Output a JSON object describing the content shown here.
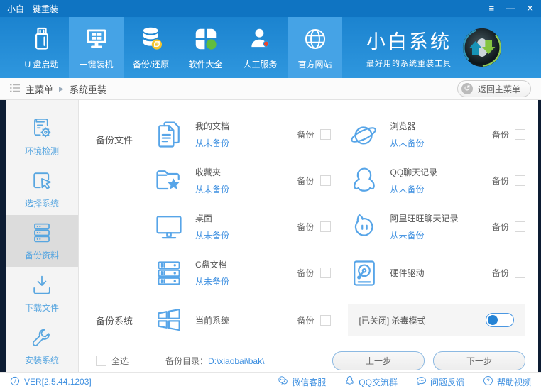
{
  "window": {
    "title": "小白一键重装",
    "controls": {
      "menu": "≡",
      "minimize": "—",
      "close": "✕"
    }
  },
  "colors": {
    "header_blue": "#1b83cf",
    "accent_blue": "#3d8fe0",
    "icon_blue": "#57a5e8",
    "active_nav": "#45a3e6",
    "green": "#61bd3e",
    "yellow": "#f6c52e",
    "red": "#e8452e",
    "dark_edge": "#0d1c33"
  },
  "nav": {
    "items": [
      {
        "key": "usb-boot",
        "label": "U 盘启动",
        "icon": "usb-drive-icon",
        "active": false
      },
      {
        "key": "onekey-install",
        "label": "一键装机",
        "icon": "monitor-icon",
        "active": true
      },
      {
        "key": "backup-restore",
        "label": "备份/还原",
        "icon": "database-icon",
        "active": false
      },
      {
        "key": "software",
        "label": "软件大全",
        "icon": "apps-icon",
        "active": false
      },
      {
        "key": "support",
        "label": "人工服务",
        "icon": "support-icon",
        "active": false
      },
      {
        "key": "official-site",
        "label": "官方网站",
        "icon": "globe-icon",
        "active": true
      }
    ],
    "brand": {
      "name": "小白系统",
      "slogan": "最好用的系统重装工具"
    }
  },
  "breadcrumb": {
    "root": "主菜单",
    "separator": "▶",
    "current": "系统重装",
    "back_button": "返回主菜单"
  },
  "sidebar": {
    "items": [
      {
        "key": "env-check",
        "label": "环境检测",
        "icon": "env-check-icon",
        "active": false
      },
      {
        "key": "select-system",
        "label": "选择系统",
        "icon": "select-system-icon",
        "active": false
      },
      {
        "key": "backup-data",
        "label": "备份资料",
        "icon": "backup-data-icon",
        "active": true
      },
      {
        "key": "download-files",
        "label": "下载文件",
        "icon": "download-icon",
        "active": false
      },
      {
        "key": "install-system",
        "label": "安装系统",
        "icon": "install-icon",
        "active": false
      }
    ]
  },
  "main": {
    "backup_files_label": "备份文件",
    "backup_system_label": "备份系统",
    "backup_checkbox_label": "备份",
    "items": [
      {
        "key": "my-documents",
        "name": "我的文档",
        "status": "从未备份",
        "icon": "documents-icon",
        "checked": false
      },
      {
        "key": "browser",
        "name": "浏览器",
        "status": "从未备份",
        "icon": "browser-icon",
        "checked": false
      },
      {
        "key": "favorites",
        "name": "收藏夹",
        "status": "从未备份",
        "icon": "favorites-icon",
        "checked": false
      },
      {
        "key": "qq-history",
        "name": "QQ聊天记录",
        "status": "从未备份",
        "icon": "qq-icon",
        "checked": false
      },
      {
        "key": "desktop",
        "name": "桌面",
        "status": "从未备份",
        "icon": "desktop-icon",
        "checked": false
      },
      {
        "key": "wangwang-history",
        "name": "阿里旺旺聊天记录",
        "status": "从未备份",
        "icon": "wangwang-icon",
        "checked": false
      },
      {
        "key": "c-drive-docs",
        "name": "C盘文档",
        "status": "从未备份",
        "icon": "cdrive-icon",
        "checked": false
      },
      {
        "key": "hardware-driver",
        "name": "硬件驱动",
        "status": "",
        "icon": "driver-icon",
        "checked": false
      }
    ],
    "system_item": {
      "key": "current-system",
      "name": "当前系统",
      "icon": "windows-icon",
      "checked": false
    },
    "antivirus": {
      "label": "[已关闭] 杀毒模式",
      "enabled": false
    },
    "select_all_label": "全选",
    "backup_dir_label": "备份目录：",
    "backup_dir": "D:\\xiaobai\\bak\\",
    "prev_button": "上一步",
    "next_button": "下一步"
  },
  "footer": {
    "version": "VER[2.5.44.1203]",
    "links": [
      {
        "key": "wechat-service",
        "label": "微信客服",
        "icon": "wechat-icon"
      },
      {
        "key": "qq-group",
        "label": "QQ交流群",
        "icon": "qq-chat-icon"
      },
      {
        "key": "feedback",
        "label": "问题反馈",
        "icon": "feedback-icon"
      },
      {
        "key": "help-videos",
        "label": "帮助视频",
        "icon": "help-icon"
      }
    ]
  }
}
